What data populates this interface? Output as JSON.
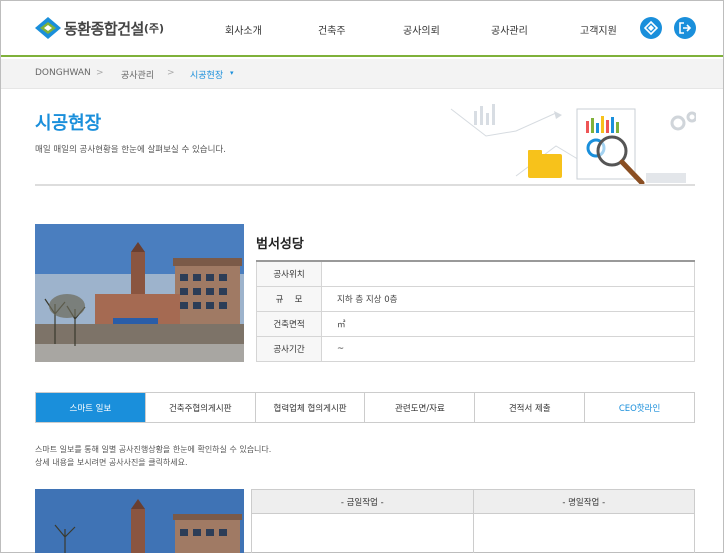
{
  "header": {
    "logo_text": "동환종합건설",
    "logo_suffix": "(주)",
    "nav": [
      "회사소개",
      "건축주",
      "공사의뢰",
      "공사관리",
      "고객지원"
    ]
  },
  "breadcrumb": {
    "home": "DONGHWAN",
    "sep": ">",
    "level1": "공사관리",
    "current": "시공현장",
    "caret": "▾"
  },
  "page": {
    "title": "시공현장",
    "description": "매일 매일의 공사현황을 한눈에 살펴보실 수 있습니다."
  },
  "site": {
    "name": "범서성당",
    "rows": [
      {
        "label": "공사위치",
        "value": ""
      },
      {
        "label": "규　 모",
        "value": "지하 층 지상 0층"
      },
      {
        "label": "건축면적",
        "value": "㎡"
      },
      {
        "label": "공사기간",
        "value": "~"
      }
    ]
  },
  "tabs": [
    "스마트 일보",
    "건축주협의게시판",
    "협력업체 협의게시판",
    "관련도면/자료",
    "견적서 제출",
    "CEO핫라인"
  ],
  "notes": [
    "스마트 일보를 통해 일별 공사진행상황을 한눈에 확인하실 수 있습니다.",
    "상세 내용을 보시려면 공사사진을 클릭하세요."
  ],
  "work_table": {
    "today": "- 금일작업 -",
    "tomorrow": "- 명일작업 -"
  },
  "colors": {
    "accent": "#1a8fdb",
    "header_line": "#7fb13a"
  }
}
